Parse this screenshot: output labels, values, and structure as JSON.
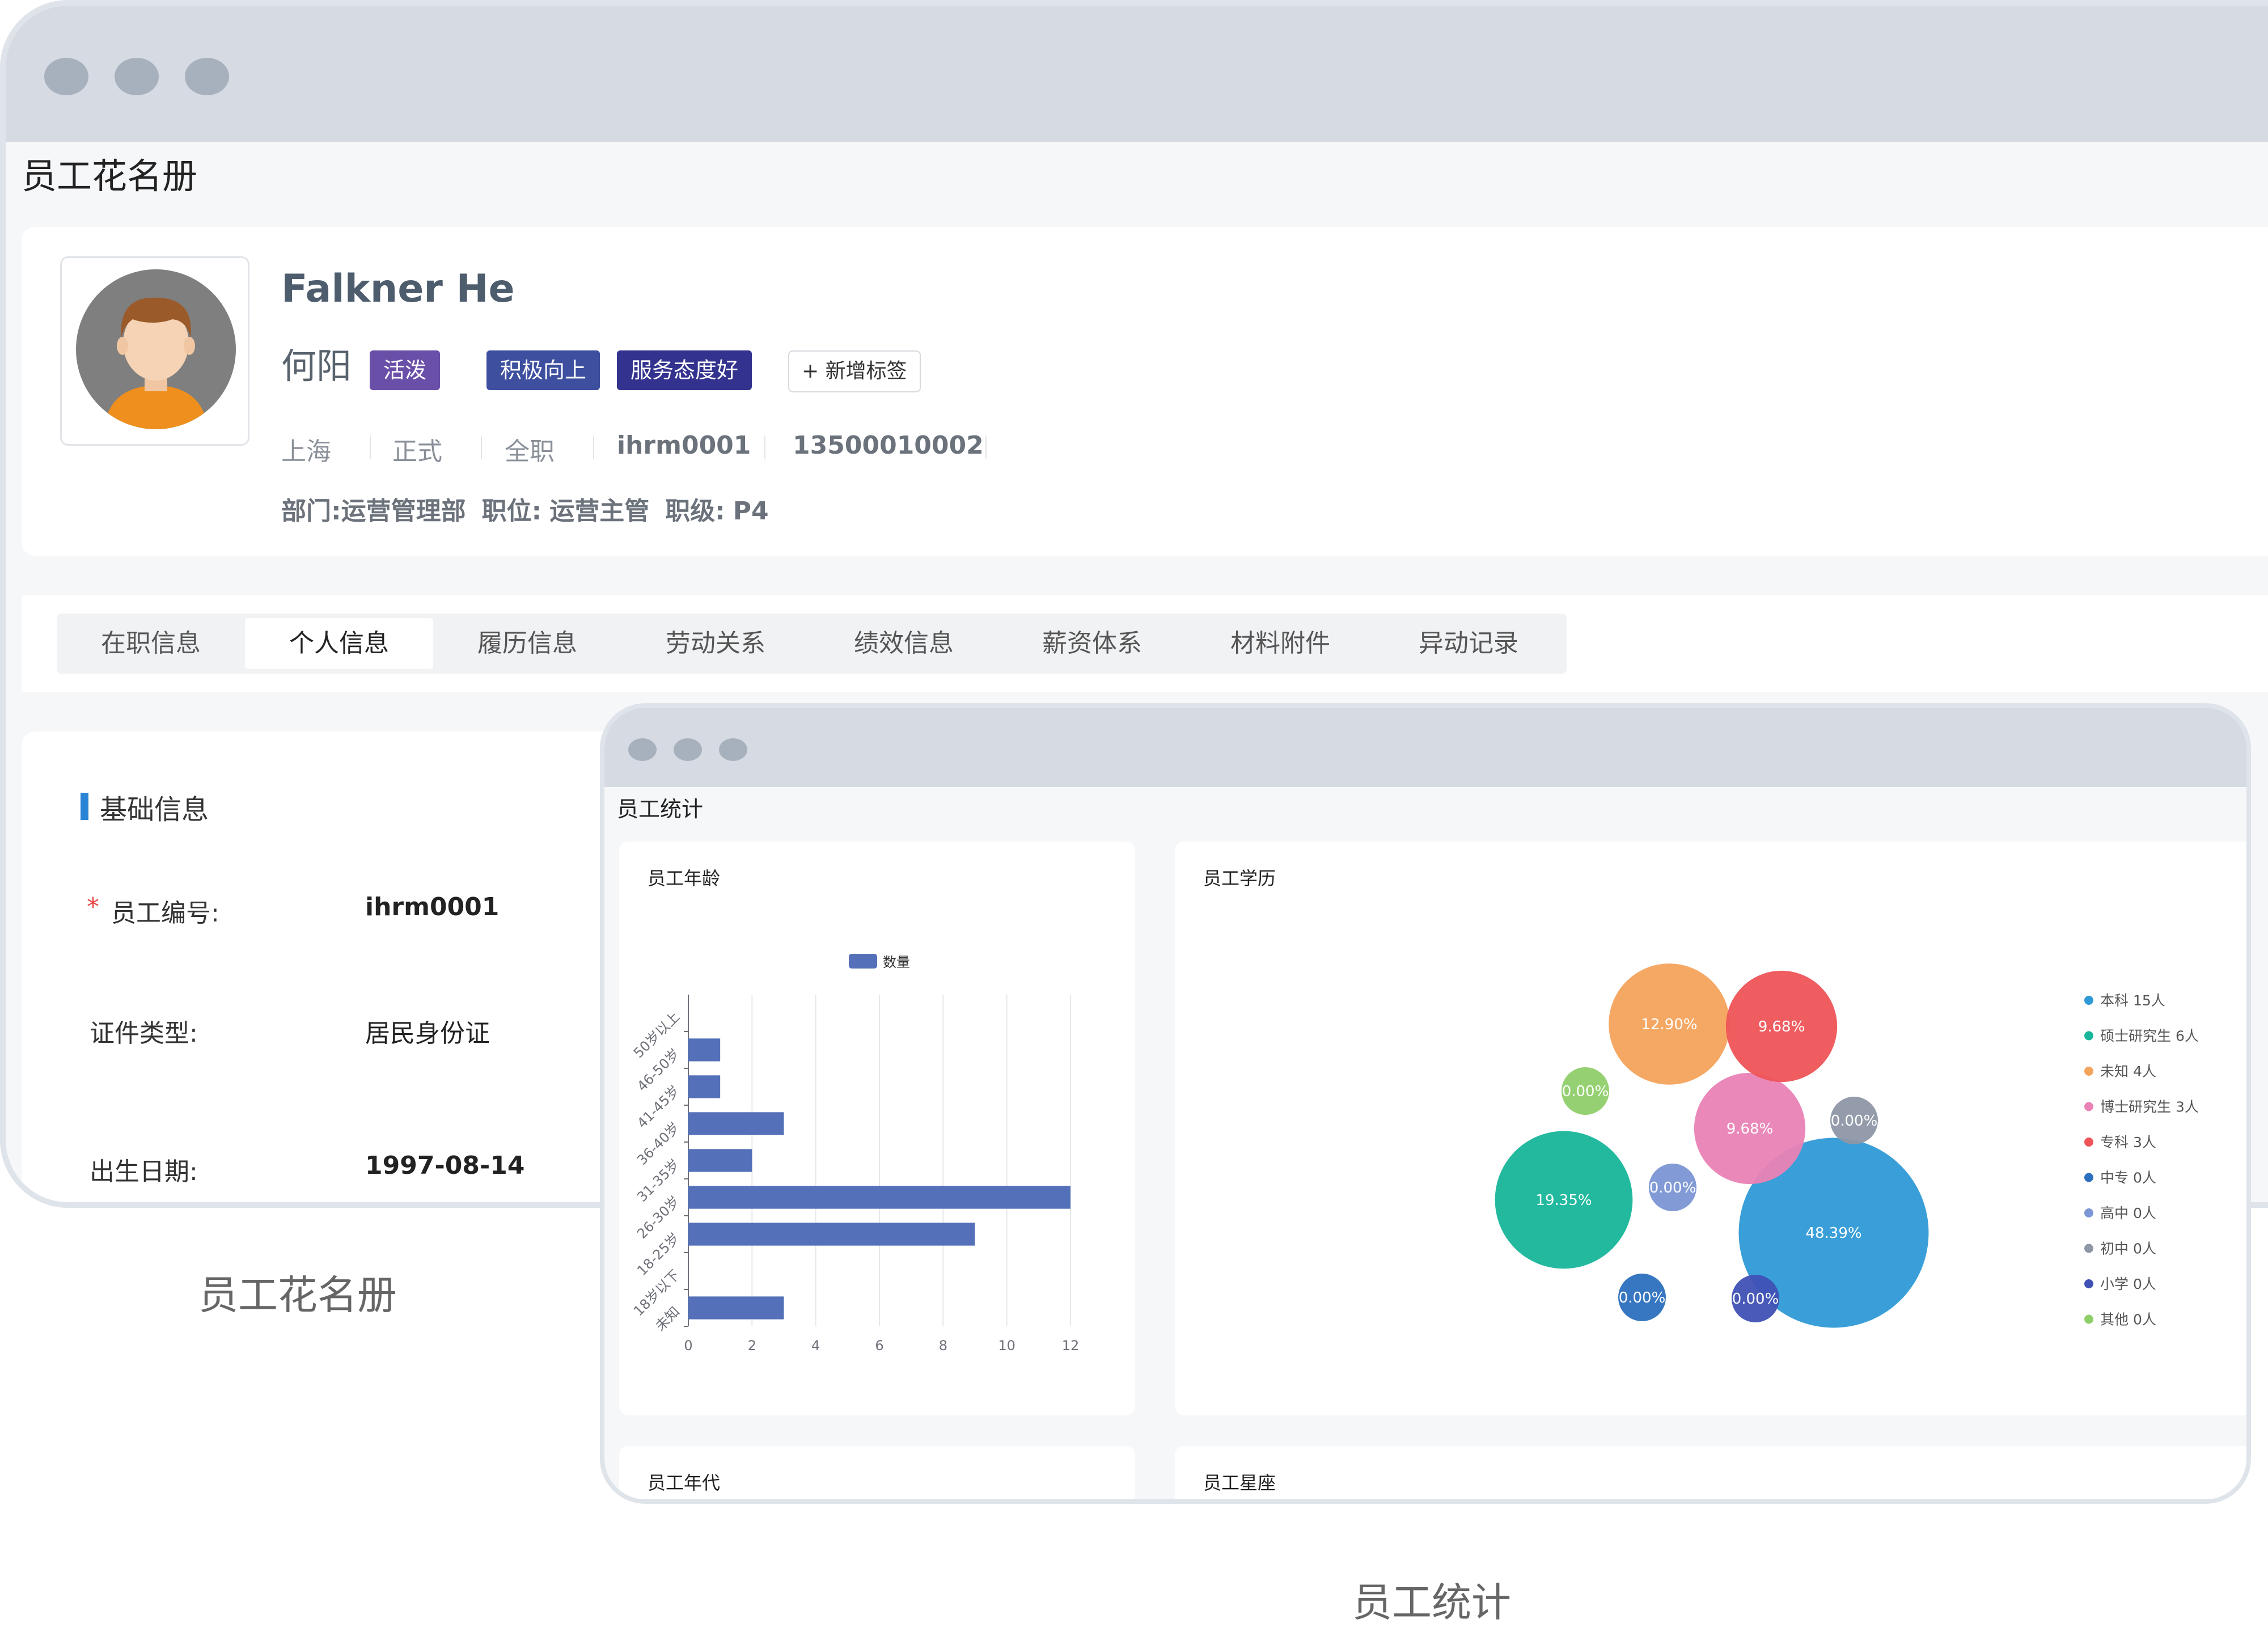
{
  "roster": {
    "page_title": "员工花名册",
    "profile": {
      "english_name": "Falkner He",
      "chinese_name": "何阳",
      "tags": [
        "活泼",
        "积极向上",
        "服务态度好"
      ],
      "tag_colors": [
        "#6a4fa8",
        "#3d4f9e",
        "#33338f"
      ],
      "add_tag_label": "+ 新增标签",
      "meta": [
        "上海",
        "正式",
        "全职",
        "ihrm0001",
        "13500010002"
      ],
      "dept_label": "部门:",
      "dept_value": "运营管理部",
      "position_label": "职位:",
      "position_value": "运营主管",
      "level_label": "职级:",
      "level_value": "P4"
    },
    "tabs": [
      "在职信息",
      "个人信息",
      "履历信息",
      "劳动关系",
      "绩效信息",
      "薪资体系",
      "材料附件",
      "异动记录"
    ],
    "active_tab": 1,
    "basic_info": {
      "title": "基础信息",
      "required_mark": "*",
      "fields": [
        {
          "label": "员工编号:",
          "value": "ihrm0001"
        },
        {
          "label": "证件类型:",
          "value": "居民身份证"
        },
        {
          "label": "出生日期:",
          "value": "1997-08-14"
        }
      ]
    },
    "caption": "员工花名册"
  },
  "stats": {
    "title": "员工统计",
    "caption": "员工统计",
    "cards": {
      "age": "员工年龄",
      "education": "员工学历",
      "generation": "员工年代",
      "zodiac": "员工星座"
    }
  },
  "chart_data": [
    {
      "type": "bar",
      "orientation": "horizontal",
      "title": "员工年龄",
      "categories": [
        "未知",
        "18岁以下",
        "18-25岁",
        "26-30岁",
        "31-35岁",
        "36-40岁",
        "41-45岁",
        "46-50岁",
        "50岁以上"
      ],
      "series": [
        {
          "name": "数量",
          "values": [
            3,
            0,
            9,
            12,
            2,
            3,
            1,
            1,
            0
          ],
          "color": "#5470b8"
        }
      ],
      "xlim": [
        0,
        12
      ],
      "xticks": [
        0,
        2,
        4,
        6,
        8,
        10,
        12
      ],
      "grid": true,
      "legend": "top"
    },
    {
      "type": "scatter",
      "subtype": "bubble",
      "title": "员工学历",
      "legend": "right",
      "items": [
        {
          "name": "本科",
          "count": 15,
          "percent": "48.39%",
          "color": "#2f9ad6"
        },
        {
          "name": "硕士研究生",
          "count": 6,
          "percent": "19.35%",
          "color": "#17b59a"
        },
        {
          "name": "未知",
          "count": 4,
          "percent": "12.90%",
          "color": "#f4a35c"
        },
        {
          "name": "博士研究生",
          "count": 3,
          "percent": "9.68%",
          "color": "#e983b5"
        },
        {
          "name": "专科",
          "count": 3,
          "percent": "9.68%",
          "color": "#ee5458"
        },
        {
          "name": "中专",
          "count": 0,
          "percent": "0.00%",
          "color": "#2c6fbd"
        },
        {
          "name": "高中",
          "count": 0,
          "percent": "0.00%",
          "color": "#7b96d4"
        },
        {
          "name": "初中",
          "count": 0,
          "percent": "0.00%",
          "color": "#8e97a6"
        },
        {
          "name": "小学",
          "count": 0,
          "percent": "0.00%",
          "color": "#3f51b5"
        },
        {
          "name": "其他",
          "count": 0,
          "percent": "0.00%",
          "color": "#8fcf6a"
        }
      ],
      "legend_unit": "人"
    }
  ]
}
